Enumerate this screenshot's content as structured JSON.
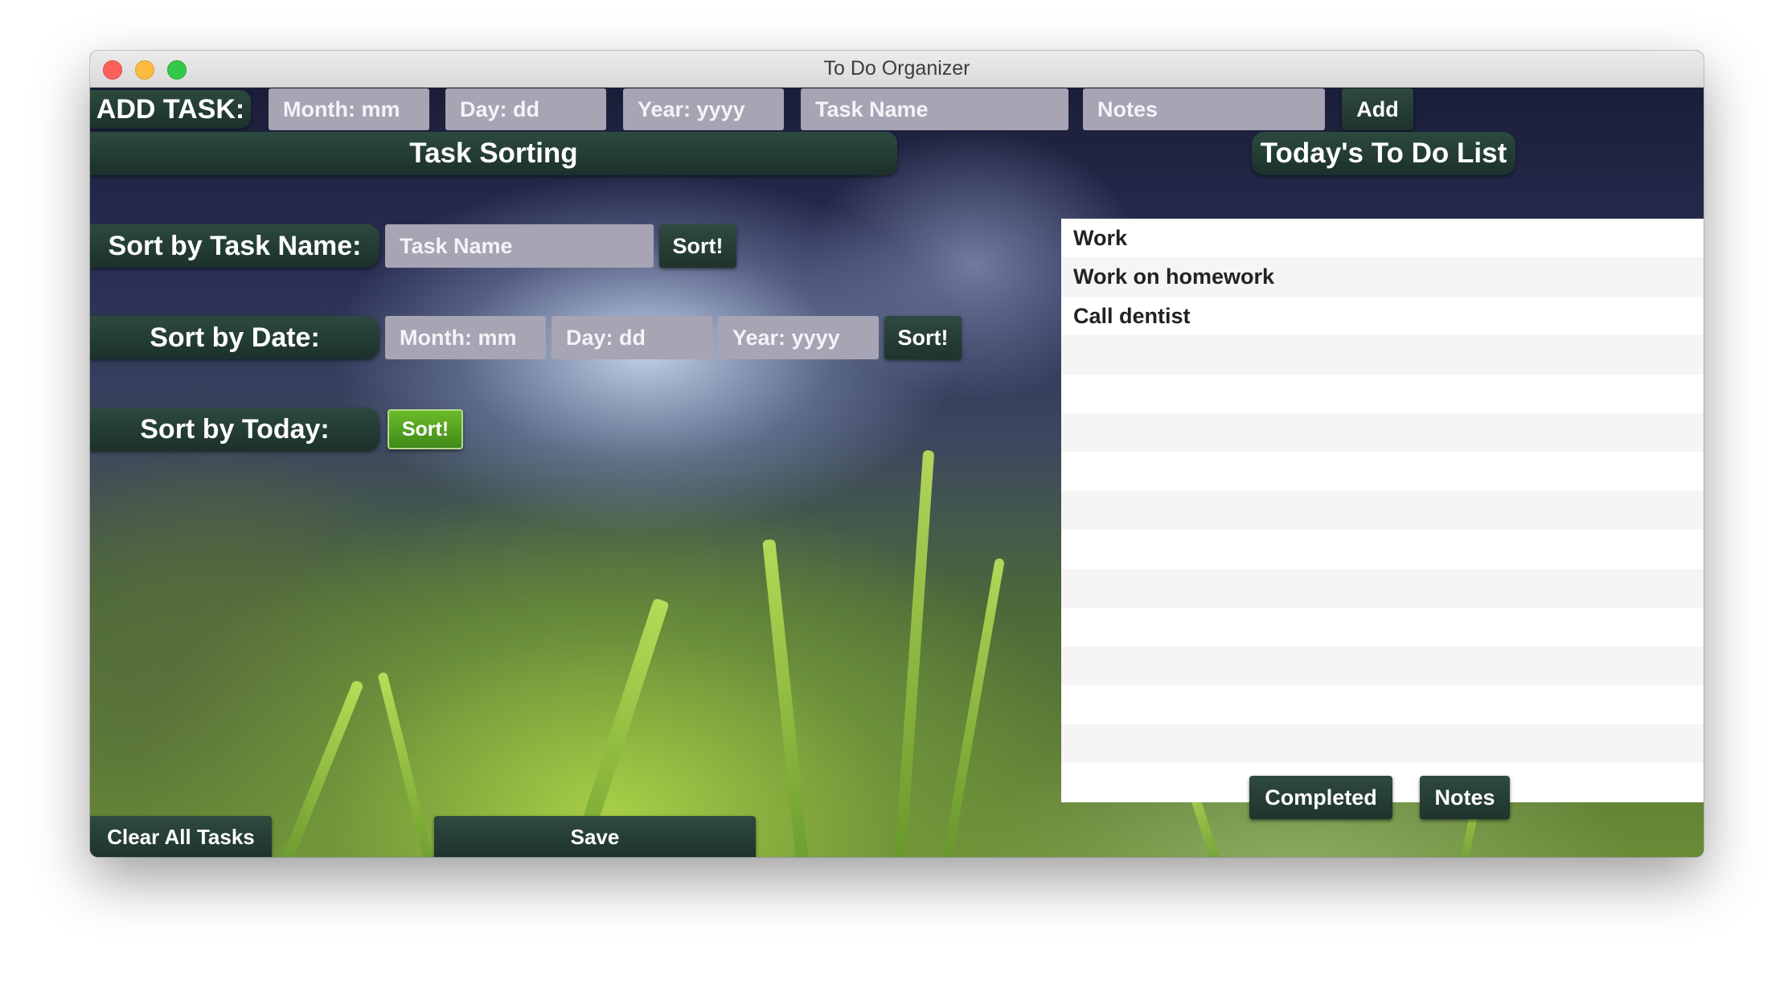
{
  "window": {
    "title": "To Do Organizer"
  },
  "add_task": {
    "label": "ADD TASK:",
    "month_placeholder": "Month: mm",
    "day_placeholder": "Day: dd",
    "year_placeholder": "Year: yyyy",
    "name_placeholder": "Task Name",
    "notes_placeholder": "Notes",
    "add_label": "Add"
  },
  "sorting": {
    "header": "Task Sorting",
    "by_name_label": "Sort by Task Name:",
    "by_name_placeholder": "Task Name",
    "by_date_label": "Sort by Date:",
    "month_placeholder": "Month: mm",
    "day_placeholder": "Day: dd",
    "year_placeholder": "Year: yyyy",
    "by_today_label": "Sort by Today:",
    "sort_label": "Sort!"
  },
  "today": {
    "header": "Today's To Do List",
    "items": [
      "Work",
      "Work on homework",
      "Call dentist",
      "",
      "",
      "",
      "",
      "",
      "",
      "",
      "",
      "",
      "",
      "",
      ""
    ],
    "completed_label": "Completed",
    "notes_label": "Notes"
  },
  "footer": {
    "clear_label": "Clear All Tasks",
    "save_label": "Save"
  },
  "colors": {
    "pill_bg": "#1f352e",
    "field_bg": "#a7a4b3",
    "sort_today_bg": "#4f9a1f"
  }
}
